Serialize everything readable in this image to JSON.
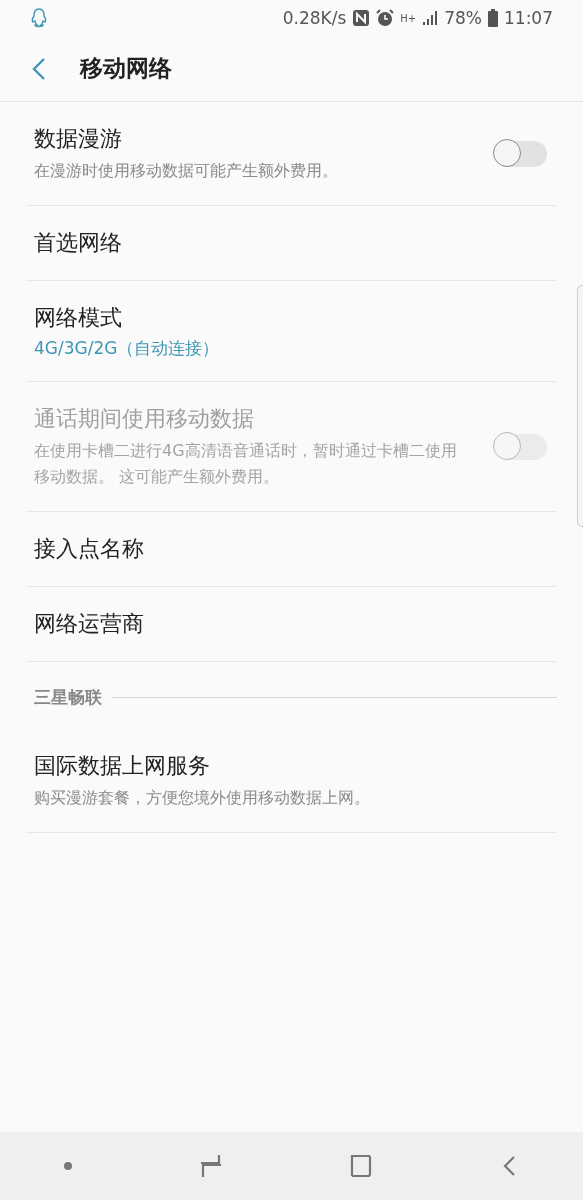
{
  "status_bar": {
    "speed": "0.28K/s",
    "network": "H+",
    "battery": "78%",
    "time": "11:07"
  },
  "header": {
    "title": "移动网络"
  },
  "items": [
    {
      "kind": "setting",
      "title": "数据漫游",
      "subtitle": "在漫游时使用移动数据可能产生额外费用。",
      "toggle": {
        "on": false
      },
      "disabled": false
    },
    {
      "kind": "setting",
      "title": "首选网络",
      "disabled": false
    },
    {
      "kind": "setting",
      "title": "网络模式",
      "value": "4G/3G/2G（自动连接）",
      "disabled": false
    },
    {
      "kind": "setting",
      "title": "通话期间使用移动数据",
      "subtitle": "在使用卡槽二进行4G高清语音通话时，暂时通过卡槽二使用移动数据。 这可能产生额外费用。",
      "toggle": {
        "on": false
      },
      "disabled": true
    },
    {
      "kind": "setting",
      "title": "接入点名称",
      "disabled": false
    },
    {
      "kind": "setting",
      "title": "网络运营商",
      "disabled": false
    },
    {
      "kind": "section",
      "title": "三星畅联"
    },
    {
      "kind": "setting",
      "title": "国际数据上网服务",
      "subtitle": "购买漫游套餐，方便您境外使用移动数据上网。",
      "disabled": false
    }
  ]
}
